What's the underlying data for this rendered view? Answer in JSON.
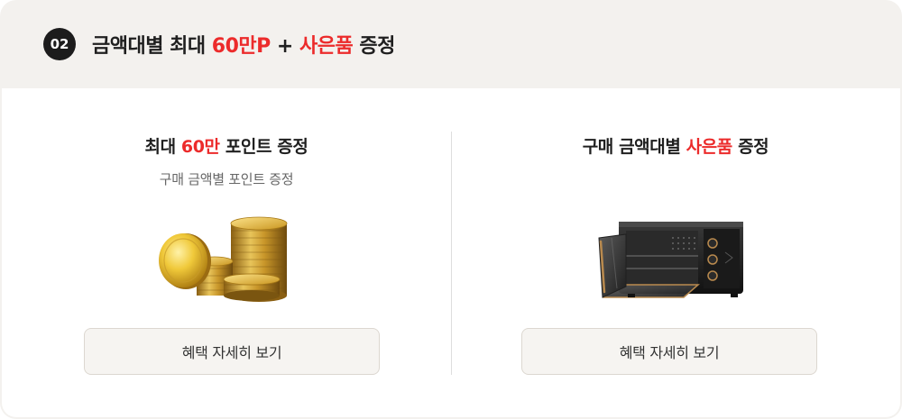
{
  "header": {
    "badge": "02",
    "title_prefix": "금액대별 최대 ",
    "title_highlight_1": "60만P",
    "title_middle": " + ",
    "title_highlight_2": "사은품",
    "title_suffix": " 증정"
  },
  "left": {
    "title_prefix": "최대 ",
    "title_highlight": "60만",
    "title_suffix": " 포인트 증정",
    "subtitle": "구매 금액별 포인트 증정",
    "image": "gold-coins",
    "button_label": "혜택 자세히 보기"
  },
  "right": {
    "title_prefix": "구매 금액대별 ",
    "title_highlight": "사은품",
    "title_suffix": " 증정",
    "image": "electric-oven",
    "button_label": "혜택 자세히 보기"
  },
  "colors": {
    "accent_red": "#ec2b2b",
    "header_bg": "#f3f1ee",
    "button_bg": "#f6f4f1",
    "badge_bg": "#1c1c1c"
  }
}
